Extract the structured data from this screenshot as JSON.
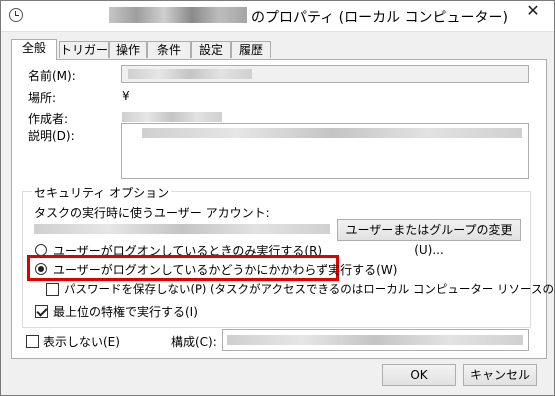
{
  "title": "のプロパティ (ローカル コンピューター)",
  "close_glyph": "✕",
  "tabs": [
    "全般",
    "トリガー",
    "操作",
    "条件",
    "設定",
    "履歴"
  ],
  "general": {
    "name_label": "名前(M):",
    "location_label": "場所:",
    "location_value": "¥",
    "author_label": "作成者:",
    "description_label": "説明(D):"
  },
  "security": {
    "group_title": "セキュリティ オプション",
    "account_label": "タスクの実行時に使うユーザー アカウント:",
    "change_user_button": "ユーザーまたはグループの変更(U)...",
    "radio_logged_on_only": "ユーザーがログオンしているときのみ実行する(R)",
    "radio_logged_on_or_not": "ユーザーがログオンしているかどうかにかかわらず実行する(W)",
    "no_store_password": "パスワードを保存しない(P) (タスクがアクセスできるのはローカル コンピューター リソースのみ)",
    "highest_privileges": "最上位の特権で実行する(I)"
  },
  "hidden_label": "表示しない(E)",
  "configure_label": "構成(C):",
  "ok_button": "OK",
  "cancel_button": "キャンセル",
  "state": {
    "radio_selected": "logged_on_or_not",
    "no_store_password_checked": false,
    "highest_privileges_checked": true,
    "hidden_checked": false
  },
  "colors": {
    "highlight": "#e00000",
    "panel": "#ffffff",
    "window": "#f0f0f0"
  }
}
